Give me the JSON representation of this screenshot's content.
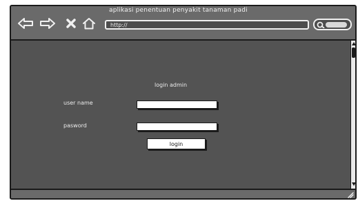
{
  "browser": {
    "title": "aplikasi penentuan penyakit tanaman padi",
    "address": "http://",
    "icons": [
      "back-arrow-icon",
      "forward-arrow-icon",
      "close-icon",
      "home-icon",
      "search-icon"
    ]
  },
  "form": {
    "heading": "login admin",
    "username_label": "user name",
    "username_value": "",
    "password_label": "pasword",
    "password_value": "",
    "submit_label": "login"
  },
  "colors": {
    "toolbar": "#6a6a6a",
    "content": "#535353",
    "text": "#ececec"
  }
}
